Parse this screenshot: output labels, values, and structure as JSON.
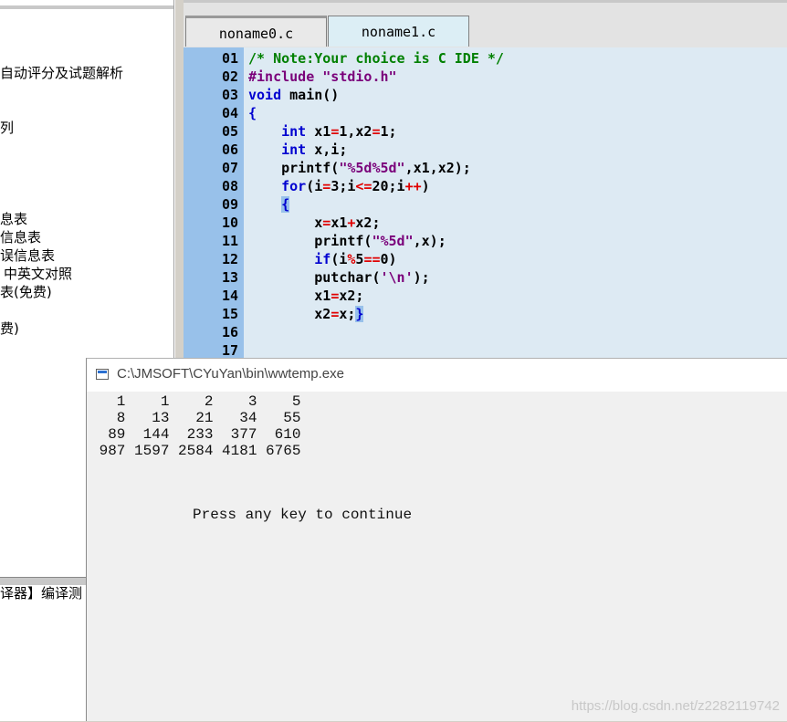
{
  "left_panel": {
    "items": [
      "自动评分及试题解析",
      "列",
      "息表",
      "信息表",
      "误信息表",
      "中英文对照",
      "表(免费)",
      "费)"
    ],
    "bottom_text": "译器】编译测"
  },
  "tabs": [
    {
      "label": "noname0.c"
    },
    {
      "label": "noname1.c"
    }
  ],
  "line_numbers": [
    "01",
    "02",
    "03",
    "04",
    "05",
    "06",
    "07",
    "08",
    "09",
    "10",
    "11",
    "12",
    "13",
    "14",
    "15",
    "16",
    "17"
  ],
  "code": {
    "l1": "/* Note:Your choice is C IDE */",
    "l2_pp": "#include ",
    "l2_str": "\"stdio.h\"",
    "l3_kw": "void",
    "l3_rest": " main()",
    "l4": "{",
    "l5_ind": "    ",
    "l5_kw": "int",
    "l5_a": " x1",
    "l5_op1": "=",
    "l5_b": "1,x2",
    "l5_op2": "=",
    "l5_c": "1;",
    "l6_ind": "    ",
    "l6_kw": "int",
    "l6_rest": " x,i;",
    "l7_a": "    printf(",
    "l7_str": "\"%5d%5d\"",
    "l7_b": ",x1,x2);",
    "l8_ind": "    ",
    "l8_kw": "for",
    "l8_a": "(i",
    "l8_op1": "=",
    "l8_b": "3;i",
    "l8_op2": "<=",
    "l8_c": "20;i",
    "l8_op3": "++",
    "l8_d": ")",
    "l9_ind": "    ",
    "l9_brace": "{",
    "l10_a": "        x",
    "l10_op1": "=",
    "l10_b": "x1",
    "l10_op2": "+",
    "l10_c": "x2;",
    "l11_a": "        printf(",
    "l11_str": "\"%5d\"",
    "l11_b": ",x);",
    "l12_ind": "        ",
    "l12_kw": "if",
    "l12_a": "(i",
    "l12_op1": "%",
    "l12_b": "5",
    "l12_op2": "==",
    "l12_c": "0)",
    "l13_a": "        putchar(",
    "l13_str": "'\\n'",
    "l13_b": ");",
    "l14_a": "        x1",
    "l14_op": "=",
    "l14_b": "x2;",
    "l15_a": "        x2",
    "l15_op": "=",
    "l15_b": "x;",
    "l15_brace": "}"
  },
  "console": {
    "title": "C:\\JMSOFT\\CYuYan\\bin\\wwtemp.exe",
    "output": [
      "   1    1    2    3    5",
      "   8   13   21   34   55",
      "  89  144  233  377  610",
      " 987 1597 2584 4181 6765"
    ],
    "press_msg": "Press any key to continue"
  },
  "watermark": "https://blog.csdn.net/z2282119742"
}
